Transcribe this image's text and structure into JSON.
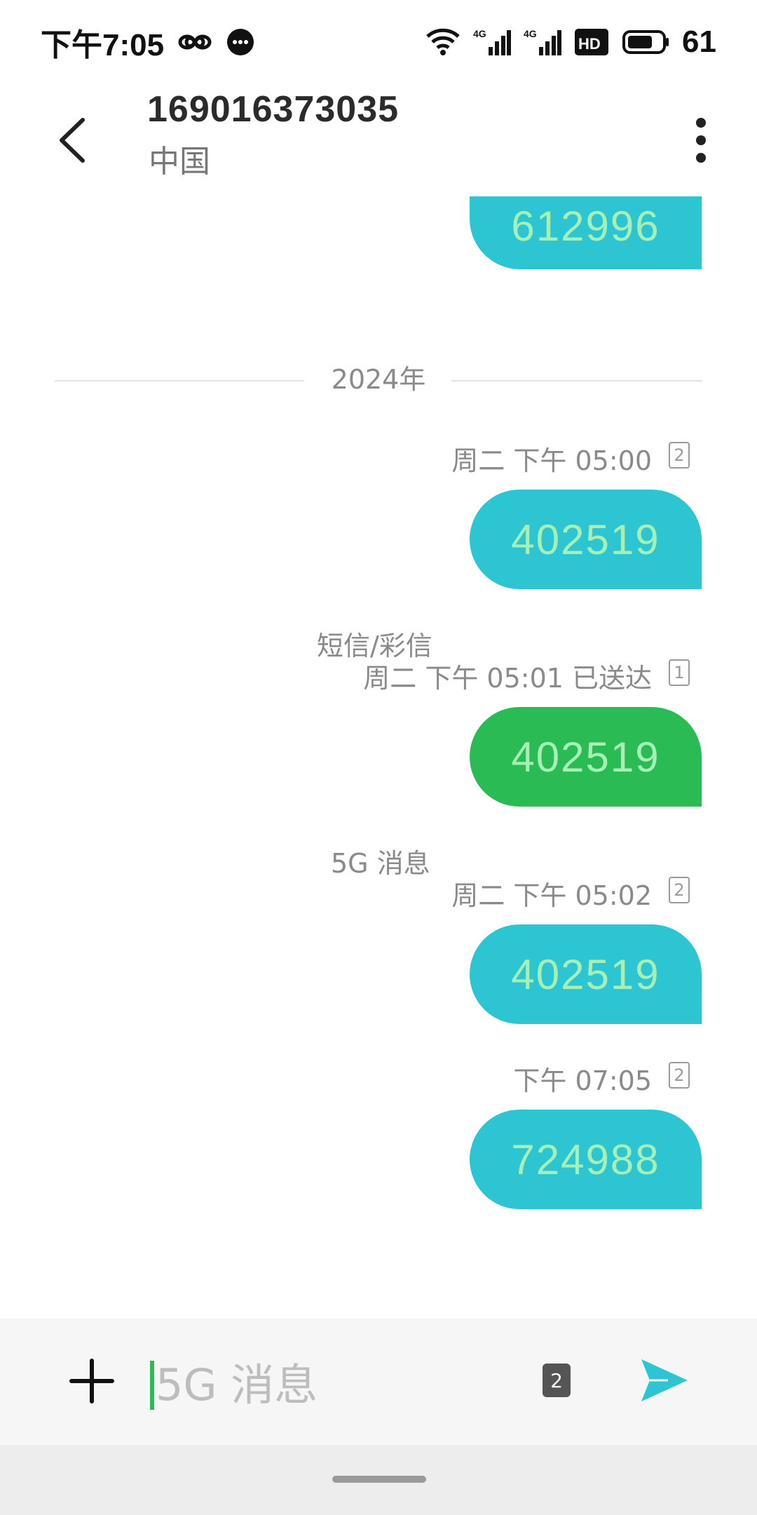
{
  "status_bar": {
    "time": "下午7:05",
    "battery_level": "61",
    "icons": [
      "infinity-icon",
      "chat-bubble-icon",
      "wifi-icon",
      "4g-signal-icon",
      "4g-signal-icon",
      "hd-icon",
      "battery-icon"
    ],
    "network_label_1": "4G",
    "network_label_2": "4G",
    "hd_label": "HD"
  },
  "header": {
    "contact_number": "169016373035",
    "contact_region": "中国"
  },
  "conversation": {
    "year_divider": "2024年",
    "messages": [
      {
        "text": "612996",
        "color": "teal",
        "partial": true
      },
      {
        "time": "周二 下午 05:00",
        "sim": "2",
        "text": "402519",
        "color": "teal"
      },
      {
        "type_label": "短信/彩信",
        "time": "周二 下午 05:01 已送达",
        "sim": "1",
        "text": "402519",
        "color": "green"
      },
      {
        "type_label": "5G 消息",
        "time": "周二 下午 05:02",
        "sim": "2",
        "text": "402519",
        "color": "teal"
      },
      {
        "time": "下午 07:05",
        "sim": "2",
        "text": "724988",
        "color": "teal"
      }
    ]
  },
  "input_bar": {
    "placeholder": "5G 消息",
    "sim_indicator": "2"
  },
  "colors": {
    "teal_bubble": "#2ec5d2",
    "green_bubble": "#2abb55",
    "bubble_text": "#a6f0b6",
    "send_icon": "#2ec5d2"
  }
}
